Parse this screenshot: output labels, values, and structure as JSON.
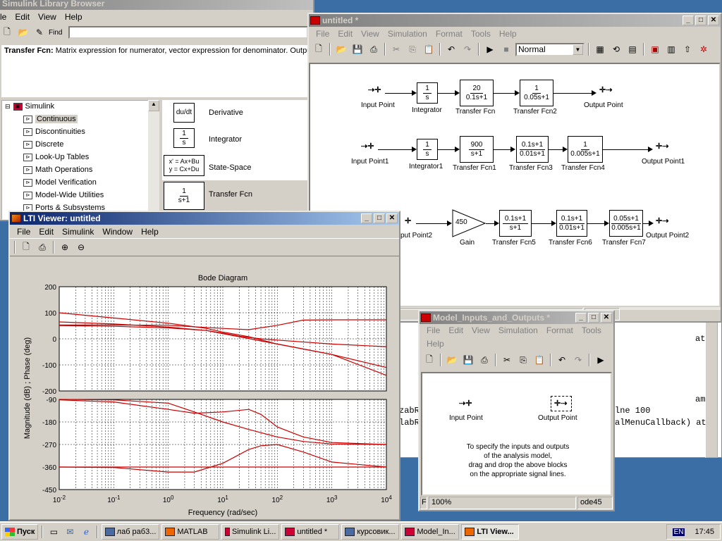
{
  "library": {
    "title": "Simulink Library Browser",
    "menu": [
      "le",
      "Edit",
      "View",
      "Help"
    ],
    "find_label": "Find",
    "description_name": "Transfer Fcn:",
    "description": " Matrix expression for numerator, vector expression for denominator.  Output w",
    "tree": [
      "Simulink",
      "Continuous",
      "Discontinuities",
      "Discrete",
      "Look-Up Tables",
      "Math Operations",
      "Model Verification",
      "Model-Wide Utilities",
      "Ports & Subsystems"
    ],
    "blocks": [
      {
        "icon": "du/dt",
        "name": "Derivative"
      },
      {
        "icon_num": "1",
        "icon_den": "s",
        "name": "Integrator"
      },
      {
        "icon_l1": "x' = Ax+Bu",
        "icon_l2": "y = Cx+Du",
        "name": "State-Space"
      },
      {
        "icon_num": "1",
        "icon_den": "s+1",
        "name": "Transfer Fcn"
      }
    ]
  },
  "model": {
    "title": "untitled *",
    "menu": [
      "File",
      "Edit",
      "View",
      "Simulation",
      "Format",
      "Tools",
      "Help"
    ],
    "sim_mode": "Normal",
    "status_right": "de45",
    "row1": {
      "in": "Input Point",
      "b1": {
        "num": "1",
        "den": "s",
        "label": "Integrator"
      },
      "b2": {
        "num": "20",
        "den": "0.1s+1",
        "label": "Transfer Fcn"
      },
      "b3": {
        "num": "1",
        "den": "0.05s+1",
        "label": "Transfer Fcn2"
      },
      "out": "Output Point"
    },
    "row2": {
      "in": "Input Point1",
      "b1": {
        "num": "1",
        "den": "s",
        "label": "Integrator1"
      },
      "b2": {
        "num": "900",
        "den": "s+1",
        "label": "Transfer Fcn1"
      },
      "b3": {
        "num": "0.1s+1",
        "den": "0.01s+1",
        "label": "Transfer Fcn3"
      },
      "b4": {
        "num": "1",
        "den": "0.005s+1",
        "label": "Transfer Fcn4"
      },
      "out": "Output Point1"
    },
    "row3": {
      "in": "put Point2",
      "gain": {
        "value": "450",
        "label": "Gain"
      },
      "b1": {
        "num": "0.1s+1",
        "den": "s+1",
        "label": "Transfer Fcn5"
      },
      "b2": {
        "num": "0.1s+1",
        "den": "0.01s+1",
        "label": "Transfer Fcn6"
      },
      "b3": {
        "num": "0.05s+1",
        "den": "0.005s+1",
        "label": "Transfer Fcn7"
      },
      "out": "Output Point2"
    }
  },
  "matlab_fragments": {
    "lines": [
      "at",
      "am",
      "zabR",
      "lne 100",
      "labR",
      "alMenuCallback) at"
    ]
  },
  "io": {
    "title": "Model_Inputs_and_Outputs *",
    "menu": [
      "File",
      "Edit",
      "View",
      "Simulation",
      "Format",
      "Tools",
      "Help"
    ],
    "input_label": "Input Point",
    "output_label": "Output Point",
    "instructions": [
      "To specify the inputs and outputs",
      "of the analysis model,",
      "drag and drop the above blocks",
      "on the appropriate signal lines."
    ],
    "status_zoom": "100%",
    "status_solver": "ode45",
    "status_left": "F"
  },
  "lti": {
    "title": "LTI Viewer: untitled",
    "menu": [
      "File",
      "Edit",
      "Simulink",
      "Window",
      "Help"
    ],
    "chart_data": {
      "type": "line",
      "title": "Bode Diagram",
      "xlabel": "Frequency  (rad/sec)",
      "ylabel": "Magnitude (dB) ; Phase (deg)",
      "xscale": "log",
      "xlim": [
        0.01,
        10000
      ],
      "x_ticks": [
        "10-2",
        "10-1",
        "100",
        "101",
        "102",
        "103",
        "104"
      ],
      "grid": true,
      "magnitude": {
        "ylim": [
          -200,
          200
        ],
        "y_ticks": [
          200,
          100,
          0,
          -100,
          -200
        ],
        "series": [
          {
            "x": [
              0.01,
              0.1,
              1,
              5,
              10,
              30,
              100,
              1000,
              10000
            ],
            "y": [
              100,
              80,
              60,
              40,
              26,
              8,
              -20,
              -60,
              -110
            ]
          },
          {
            "x": [
              0.01,
              0.1,
              1,
              5,
              10,
              20,
              50,
              100,
              1000,
              10000
            ],
            "y": [
              65,
              57,
              45,
              32,
              20,
              8,
              -8,
              -20,
              -60,
              -140
            ]
          },
          {
            "x": [
              0.01,
              0.1,
              1,
              5,
              10,
              20,
              50,
              100,
              1000,
              10000
            ],
            "y": [
              51,
              48,
              42,
              32,
              22,
              10,
              0,
              -5,
              -20,
              -30
            ]
          },
          {
            "x": [
              0.01,
              0.1,
              1,
              10,
              30,
              100,
              300,
              1000,
              10000
            ],
            "y": [
              53,
              53,
              52,
              40,
              35,
              52,
              72,
              73,
              73
            ]
          }
        ]
      },
      "phase": {
        "ylim": [
          -450,
          -90
        ],
        "y_ticks": [
          -90,
          -180,
          -270,
          -360,
          -450
        ],
        "series": [
          {
            "x": [
              0.01,
              0.1,
              1,
              3,
              10,
              30,
              100,
              300,
              1000,
              10000
            ],
            "y": [
              -90,
              -92,
              -105,
              -140,
              -180,
              -210,
              -240,
              -258,
              -268,
              -270
            ]
          },
          {
            "x": [
              0.01,
              0.1,
              1,
              3,
              10,
              30,
              50,
              100,
              300,
              1000,
              10000
            ],
            "y": [
              -92,
              -100,
              -130,
              -145,
              -140,
              -130,
              -150,
              -200,
              -240,
              -262,
              -270
            ]
          },
          {
            "x": [
              0.01,
              0.1,
              1,
              3,
              10,
              30,
              50,
              100,
              300,
              1000,
              10000
            ],
            "y": [
              -360,
              -362,
              -380,
              -380,
              -345,
              -290,
              -275,
              -270,
              -300,
              -340,
              -360
            ]
          },
          {
            "x": [
              0.01,
              0.1,
              1,
              10,
              100,
              1000,
              10000
            ],
            "y": [
              -360,
              -360,
              -360,
              -360,
              -360,
              -360,
              -360
            ]
          }
        ]
      }
    }
  },
  "taskbar": {
    "start": "Пуск",
    "items": [
      "лаб раб3...",
      "MATLAB",
      "Simulink Li...",
      "untitled *",
      "курсовик...",
      "Model_In...",
      "LTI View..."
    ],
    "lang": "EN",
    "clock": "17:45"
  }
}
